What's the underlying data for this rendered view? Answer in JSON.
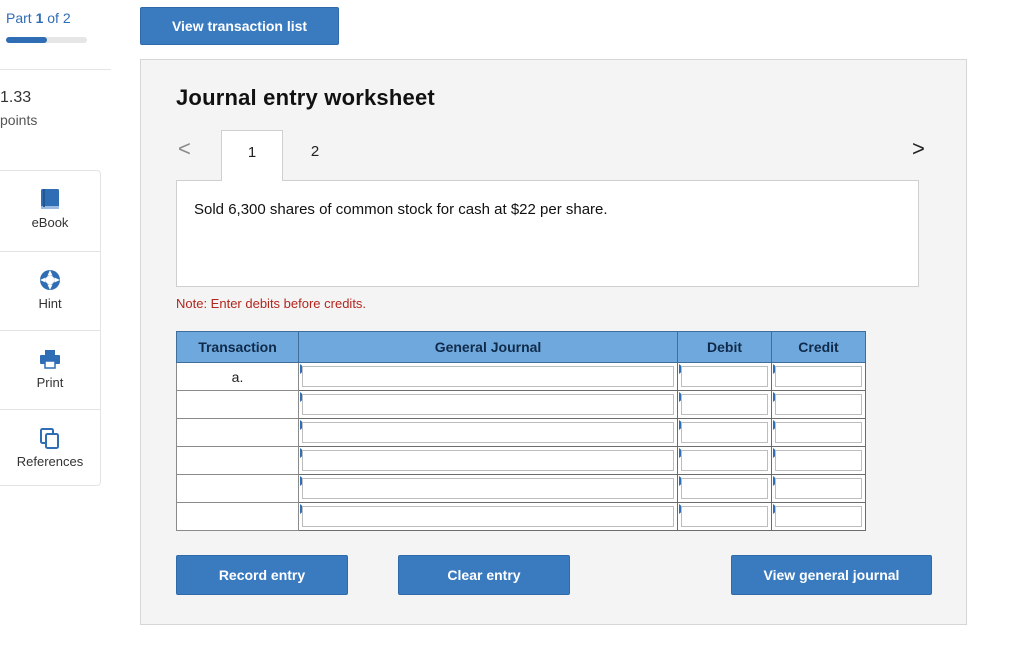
{
  "header": {
    "part_prefix": "Part",
    "part_current": "1",
    "part_suffix": "of 2",
    "progress": 0.5,
    "view_transactions_label": "View transaction list"
  },
  "score": {
    "points_value": "1.33",
    "points_label": "points"
  },
  "tools": [
    {
      "label": "eBook",
      "icon": "book-icon"
    },
    {
      "label": "Hint",
      "icon": "lifebuoy-icon"
    },
    {
      "label": "Print",
      "icon": "printer-icon"
    },
    {
      "label": "References",
      "icon": "copy-icon"
    }
  ],
  "worksheet": {
    "title": "Journal entry worksheet",
    "prev_glyph": "<",
    "next_glyph": ">",
    "tabs": [
      "1",
      "2"
    ],
    "active_tab": "1",
    "description": "Sold 6,300 shares of common stock for cash at $22 per share.",
    "note": "Note: Enter debits before credits.",
    "table": {
      "headers": [
        "Transaction",
        "General Journal",
        "Debit",
        "Credit"
      ],
      "rows": [
        {
          "transaction": "a."
        },
        {
          "transaction": ""
        },
        {
          "transaction": ""
        },
        {
          "transaction": ""
        },
        {
          "transaction": ""
        },
        {
          "transaction": ""
        }
      ]
    },
    "buttons": {
      "record": "Record entry",
      "clear": "Clear entry",
      "view_journal": "View general journal"
    }
  },
  "colors": {
    "accent": "#3a7bc0",
    "table_header": "#6fa8dc",
    "note": "#b3261e"
  }
}
